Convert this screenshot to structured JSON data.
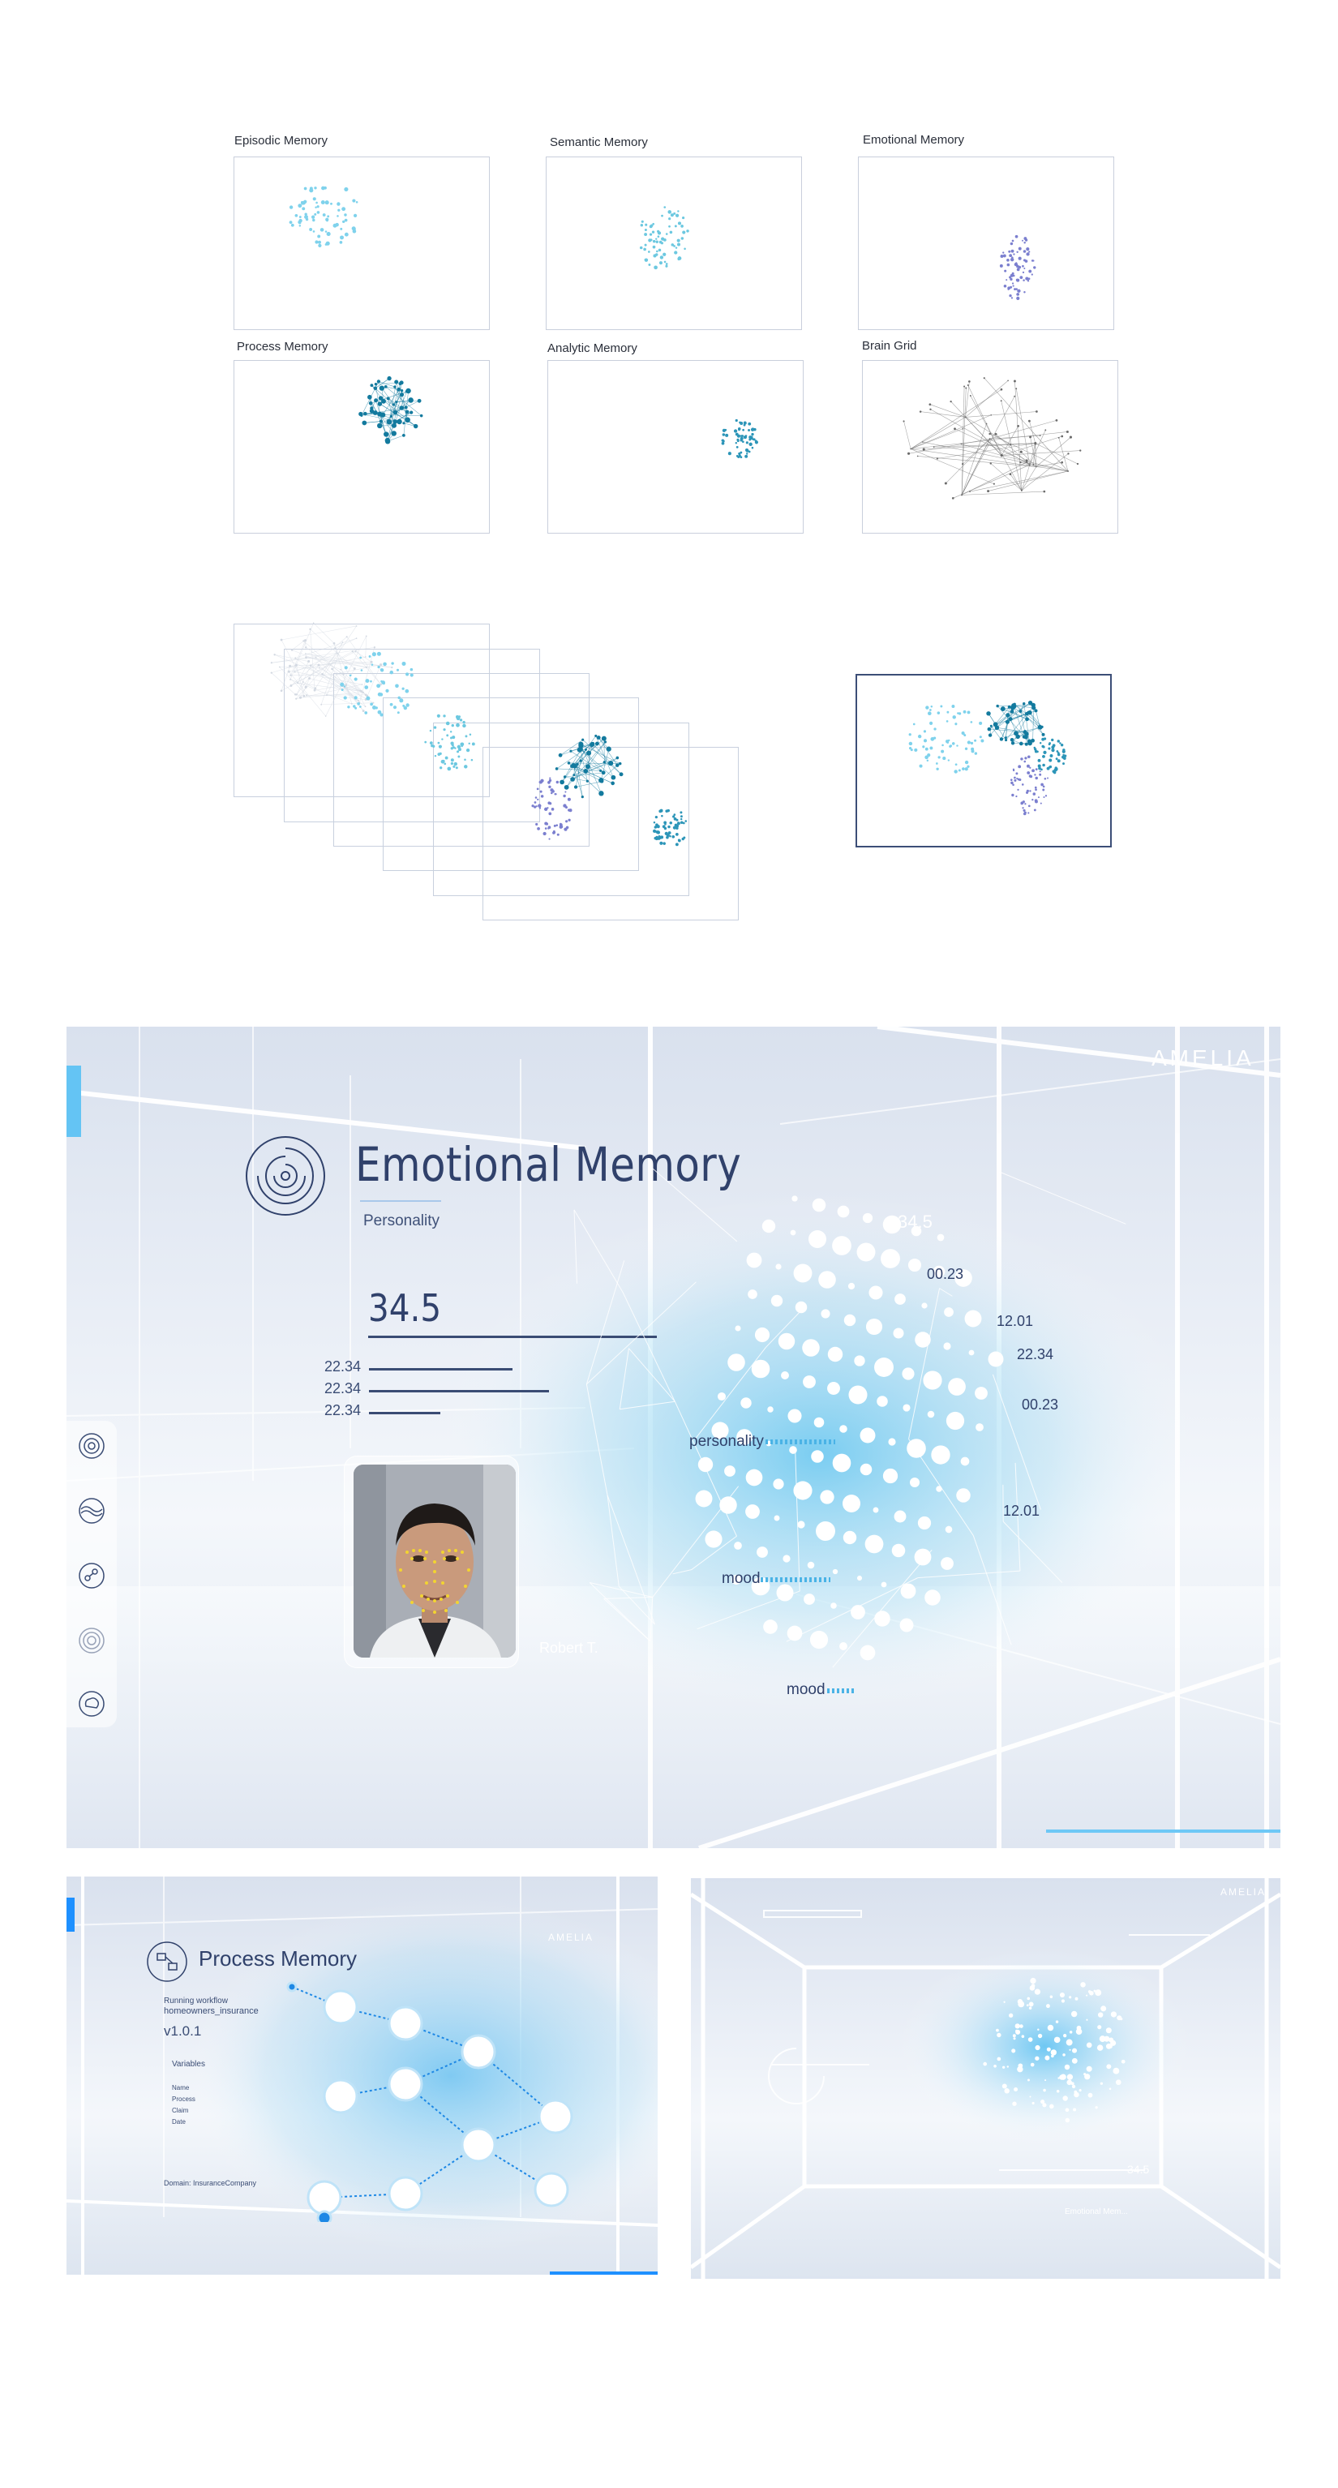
{
  "thumbnails": [
    {
      "label": "Episodic Memory"
    },
    {
      "label": "Semantic Memory"
    },
    {
      "label": "Emotional Memory"
    },
    {
      "label": "Process Memory"
    },
    {
      "label": "Analytic Memory"
    },
    {
      "label": "Brain Grid"
    }
  ],
  "colors": {
    "episodic": "#7fd2ec",
    "semantic": "#6cc8e0",
    "emotional": "#7b7fcf",
    "process": "#137a9e",
    "analytic": "#2c95b8",
    "grid": "#6b6b6b",
    "title": "#30416b",
    "accent": "#64c4f4"
  },
  "emotional_panel": {
    "brand": "AMELIA",
    "title": "Emotional Memory",
    "subtitle": "Personality",
    "main_value": "34.5",
    "values": [
      "22.34",
      "22.34",
      "22.34"
    ],
    "face_name": "Robert T.",
    "sidebar_icons": [
      "spiral-icon",
      "wave-icon",
      "process-icon",
      "fingerprint-icon",
      "brain-icon"
    ],
    "cloud_numbers": [
      "34.5",
      "00.23",
      "12.01",
      "22.34",
      "00.23",
      "12.01"
    ],
    "tags": [
      "personality",
      "mood",
      "mood"
    ]
  },
  "process_panel": {
    "title": "Process Memory",
    "brand": "AMELIA",
    "workflow_label": "Running workflow",
    "workflow_name": "homeowners_insurance",
    "version": "v1.0.1",
    "variables_label": "Variables",
    "variables": [
      "Name",
      "Process",
      "Claim",
      "Date"
    ],
    "domain": "Domain: InsuranceCompany"
  },
  "third_panel": {
    "brand": "AMELIA",
    "value": "34.5",
    "footer": "Emotional Mem..."
  }
}
